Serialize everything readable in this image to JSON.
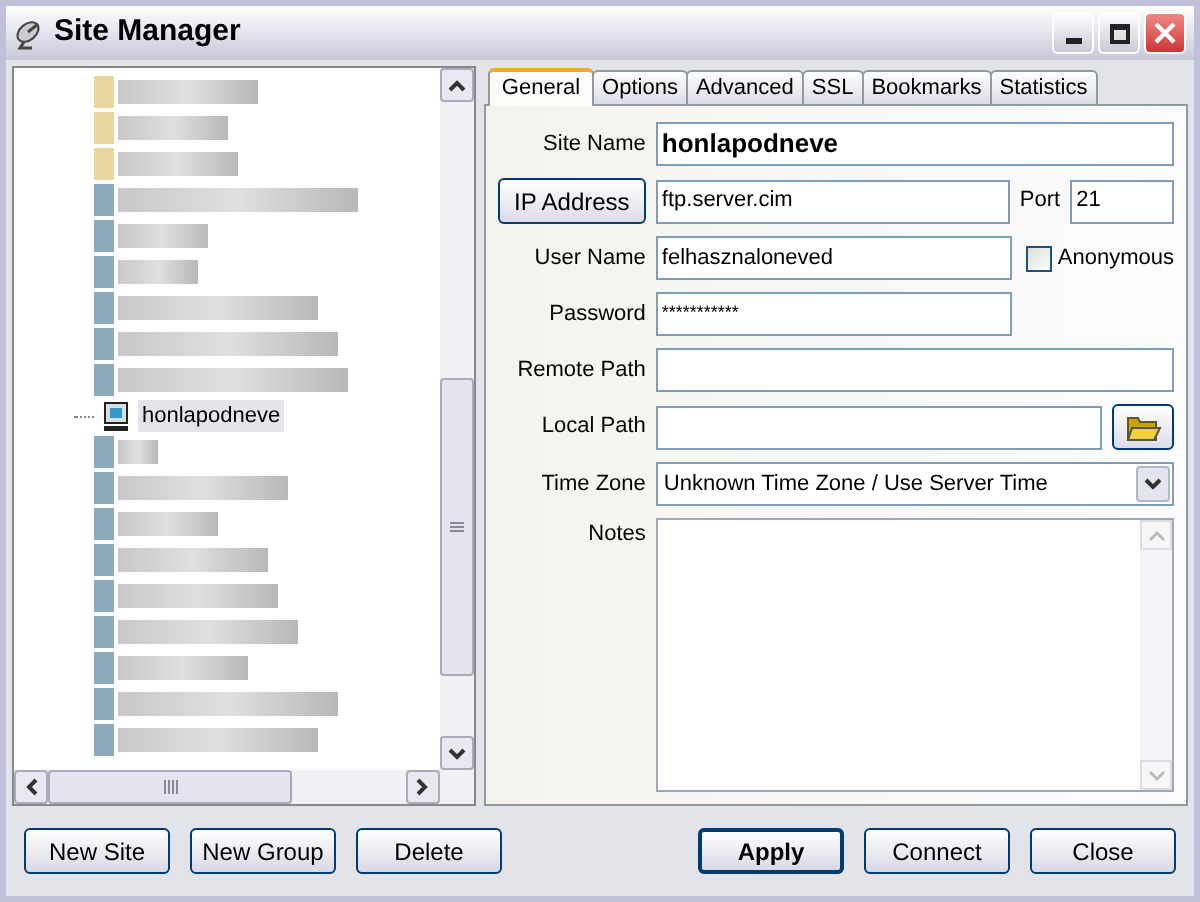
{
  "window": {
    "title": "Site Manager"
  },
  "tree": {
    "items": [
      {
        "kind": "redacted"
      },
      {
        "kind": "redacted"
      },
      {
        "kind": "redacted"
      },
      {
        "kind": "redacted"
      },
      {
        "kind": "redacted"
      },
      {
        "kind": "redacted"
      },
      {
        "kind": "redacted"
      },
      {
        "kind": "redacted"
      },
      {
        "kind": "redacted"
      },
      {
        "kind": "site",
        "label": "honlapodneve",
        "selected": true
      },
      {
        "kind": "redacted"
      },
      {
        "kind": "redacted"
      },
      {
        "kind": "redacted"
      },
      {
        "kind": "redacted"
      },
      {
        "kind": "redacted"
      },
      {
        "kind": "redacted"
      },
      {
        "kind": "redacted"
      },
      {
        "kind": "redacted"
      },
      {
        "kind": "redacted"
      }
    ]
  },
  "tabs": [
    {
      "label": "General",
      "selected": true
    },
    {
      "label": "Options",
      "selected": false
    },
    {
      "label": "Advanced",
      "selected": false
    },
    {
      "label": "SSL",
      "selected": false
    },
    {
      "label": "Bookmarks",
      "selected": false
    },
    {
      "label": "Statistics",
      "selected": false
    }
  ],
  "form": {
    "site_name": {
      "label": "Site Name",
      "value": "honlapodneve"
    },
    "ip_address": {
      "label": "IP Address",
      "value": "ftp.server.cim"
    },
    "port": {
      "label": "Port",
      "value": "21"
    },
    "user_name": {
      "label": "User Name",
      "value": "felhasznaloneved"
    },
    "anonymous": {
      "label": "Anonymous",
      "checked": false
    },
    "password": {
      "label": "Password",
      "value": "***********"
    },
    "remote_path": {
      "label": "Remote Path"
    },
    "local_path": {
      "label": "Local Path"
    },
    "time_zone": {
      "label": "Time Zone",
      "value": "Unknown Time Zone / Use Server Time"
    },
    "notes": {
      "label": "Notes"
    }
  },
  "left_buttons": [
    "New Site",
    "New Group",
    "Delete"
  ],
  "right_buttons": [
    {
      "label": "Apply",
      "default": true
    },
    {
      "label": "Connect",
      "default": false
    },
    {
      "label": "Close",
      "default": false
    }
  ]
}
